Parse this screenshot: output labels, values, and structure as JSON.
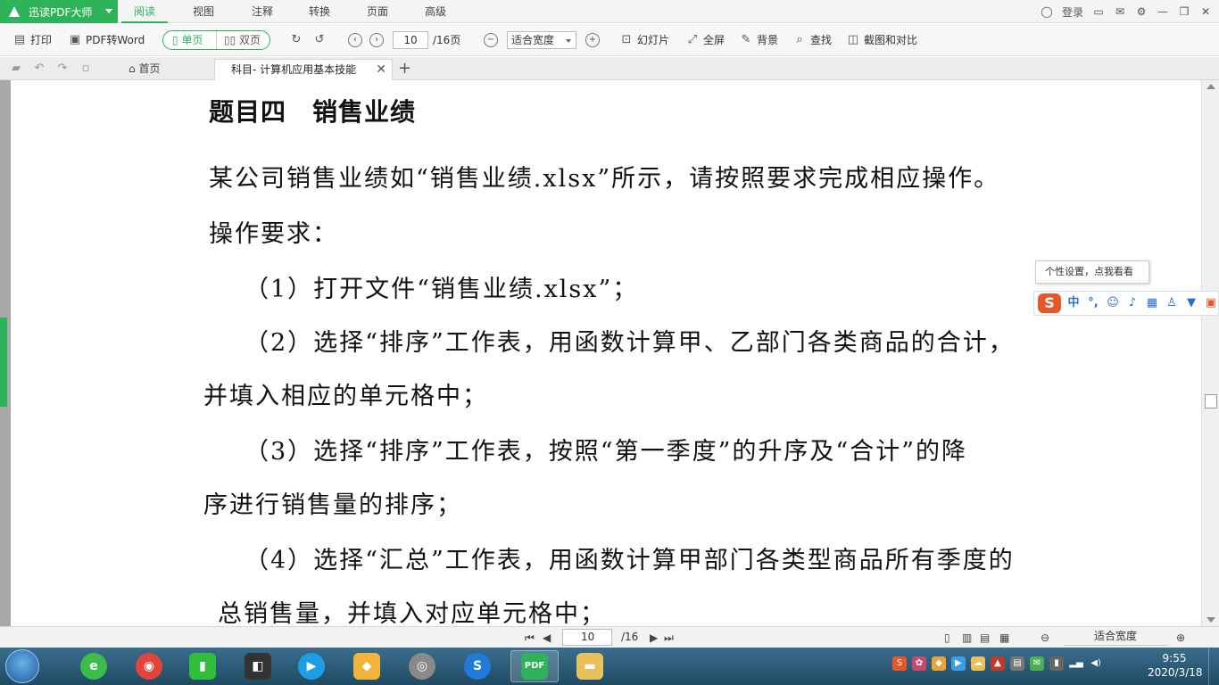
{
  "app": {
    "brand": "迅读PDF大师",
    "menu": [
      "阅读",
      "视图",
      "注释",
      "转换",
      "页面",
      "高级"
    ],
    "login": "登录"
  },
  "toolbar": {
    "print": "打印",
    "pdf_to_word": "PDF转Word",
    "single_page": "单页",
    "double_page": "双页",
    "current_page": "10",
    "total_pages": "/16页",
    "zoom": "适合宽度",
    "slideshow": "幻灯片",
    "fullscreen": "全屏",
    "background": "背景",
    "find": "查找",
    "screenshot_compare": "截图和对比"
  },
  "tabs": {
    "home": "首页",
    "document": "科目- 计算机应用基本技能"
  },
  "document": {
    "heading": "题目四　销售业绩",
    "paragraphs": [
      "某公司销售业绩如“销售业绩.xlsx”所示，请按照要求完成相应操作。",
      "操作要求：",
      "（1）打开文件“销售业绩.xlsx”；",
      "（2）选择“排序”工作表，用函数计算甲、乙部门各类商品的合计，",
      "并填入相应的单元格中；",
      "（3）选择“排序”工作表，按照“第一季度”的升序及“合计”的降",
      "序进行销售量的排序；",
      "（4）选择“汇总”工作表，用函数计算甲部门各类型商品所有季度的",
      "总销售量，并填入对应单元格中；"
    ]
  },
  "ime": {
    "tip": "个性设置，点我看看",
    "mode": "中"
  },
  "statusbar": {
    "current_page": "10",
    "total": "/16",
    "zoom": "适合宽度"
  },
  "taskbar": {
    "time": "9:55",
    "date": "2020/3/18",
    "pdf_app_label": "PDF"
  },
  "colors": {
    "accent": "#2fb35a",
    "taskbar": "#2a5a76"
  }
}
